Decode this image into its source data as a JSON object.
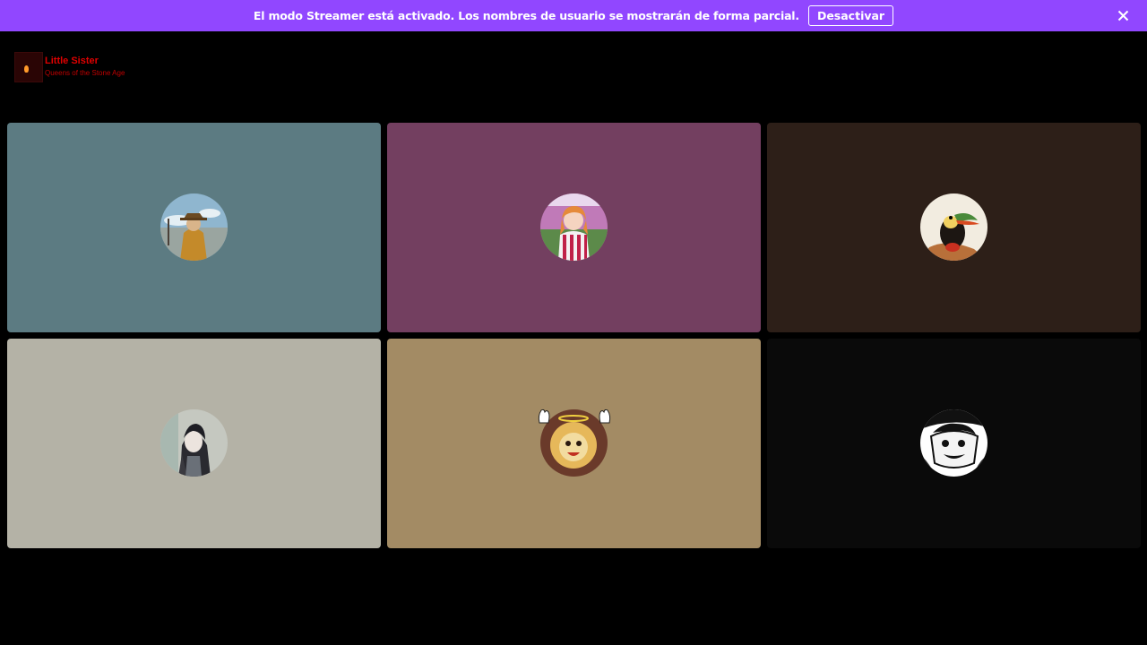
{
  "banner": {
    "message": "El modo Streamer está activado. Los nombres de usuario se mostrarán de forma parcial.",
    "button_label": "Desactivar",
    "background": "#9147ff",
    "close_icon": "close-icon"
  },
  "overlay": {
    "title": "Little Sister",
    "subtitle": "Queens of the Stone Age",
    "logo_icon": "album-cover-icon"
  },
  "participants": [
    {
      "tile_color": "#5c7b82",
      "avatar": "avatar-person-in-hat-icon"
    },
    {
      "tile_color": "#733f60",
      "avatar": "avatar-anime-girl-striped-shirt-icon"
    },
    {
      "tile_color": "#2d1f18",
      "avatar": "avatar-toucan-bird-icon"
    },
    {
      "tile_color": "#b4b2a6",
      "avatar": "avatar-dark-haired-girl-icon"
    },
    {
      "tile_color": "#a38b64",
      "avatar": "avatar-lion-with-halo-icon"
    },
    {
      "tile_color": "#0a0a0a",
      "avatar": "avatar-manga-pirate-icon"
    }
  ]
}
